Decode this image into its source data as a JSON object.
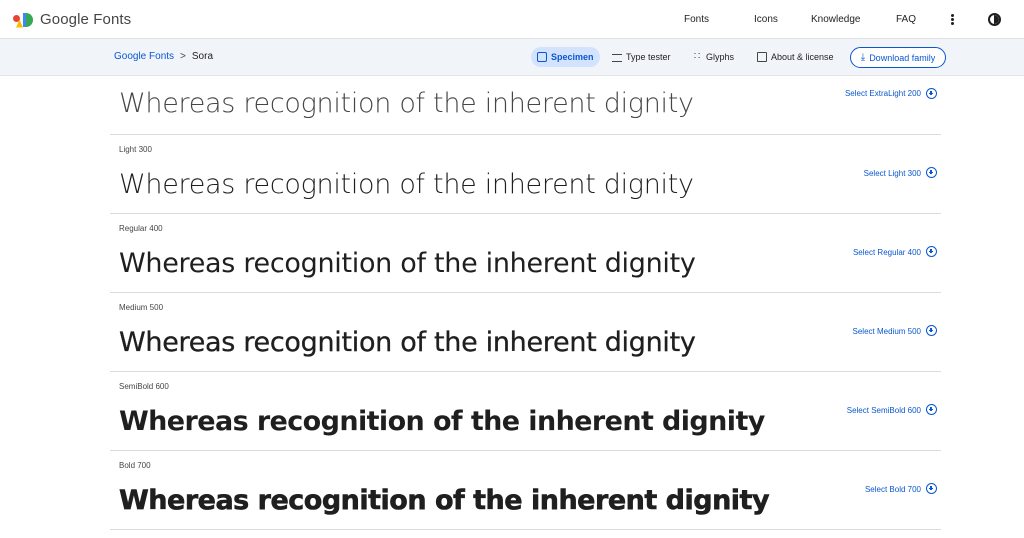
{
  "header": {
    "logo_text": "Google Fonts",
    "nav": [
      "Fonts",
      "Icons",
      "Knowledge",
      "FAQ"
    ]
  },
  "subnav": {
    "breadcrumb": {
      "parent": "Google Fonts",
      "separator": ">",
      "current": "Sora"
    },
    "tabs": [
      "Specimen",
      "Type tester",
      "Glyphs",
      "About & license"
    ],
    "active_tab": "Specimen",
    "download_label": "Download family"
  },
  "styles": [
    {
      "label": "",
      "sample": "Whereas recognition of the inherent dignity",
      "select": "Select ExtraLight 200",
      "weight": 200
    },
    {
      "label": "Light 300",
      "sample": "Whereas recognition of the inherent dignity",
      "select": "Select Light 300",
      "weight": 300
    },
    {
      "label": "Regular 400",
      "sample": "Whereas recognition of the inherent dignity",
      "select": "Select Regular 400",
      "weight": 400
    },
    {
      "label": "Medium 500",
      "sample": "Whereas recognition of the inherent dignity",
      "select": "Select Medium 500",
      "weight": 500
    },
    {
      "label": "SemiBold 600",
      "sample": "Whereas recognition of the inherent dignity",
      "select": "Select SemiBold 600",
      "weight": 600
    },
    {
      "label": "Bold 700",
      "sample": "Whereas recognition of the inherent dignity",
      "select": "Select Bold 700",
      "weight": 700
    }
  ],
  "colors": {
    "link": "#0b57d0",
    "subbar_bg": "#f1f4f9",
    "active_tab_bg": "#d3e3fd"
  },
  "icons": {
    "download": "download-icon",
    "menu": "more-vert-icon",
    "theme": "brightness-icon",
    "add": "add-circle-icon"
  }
}
